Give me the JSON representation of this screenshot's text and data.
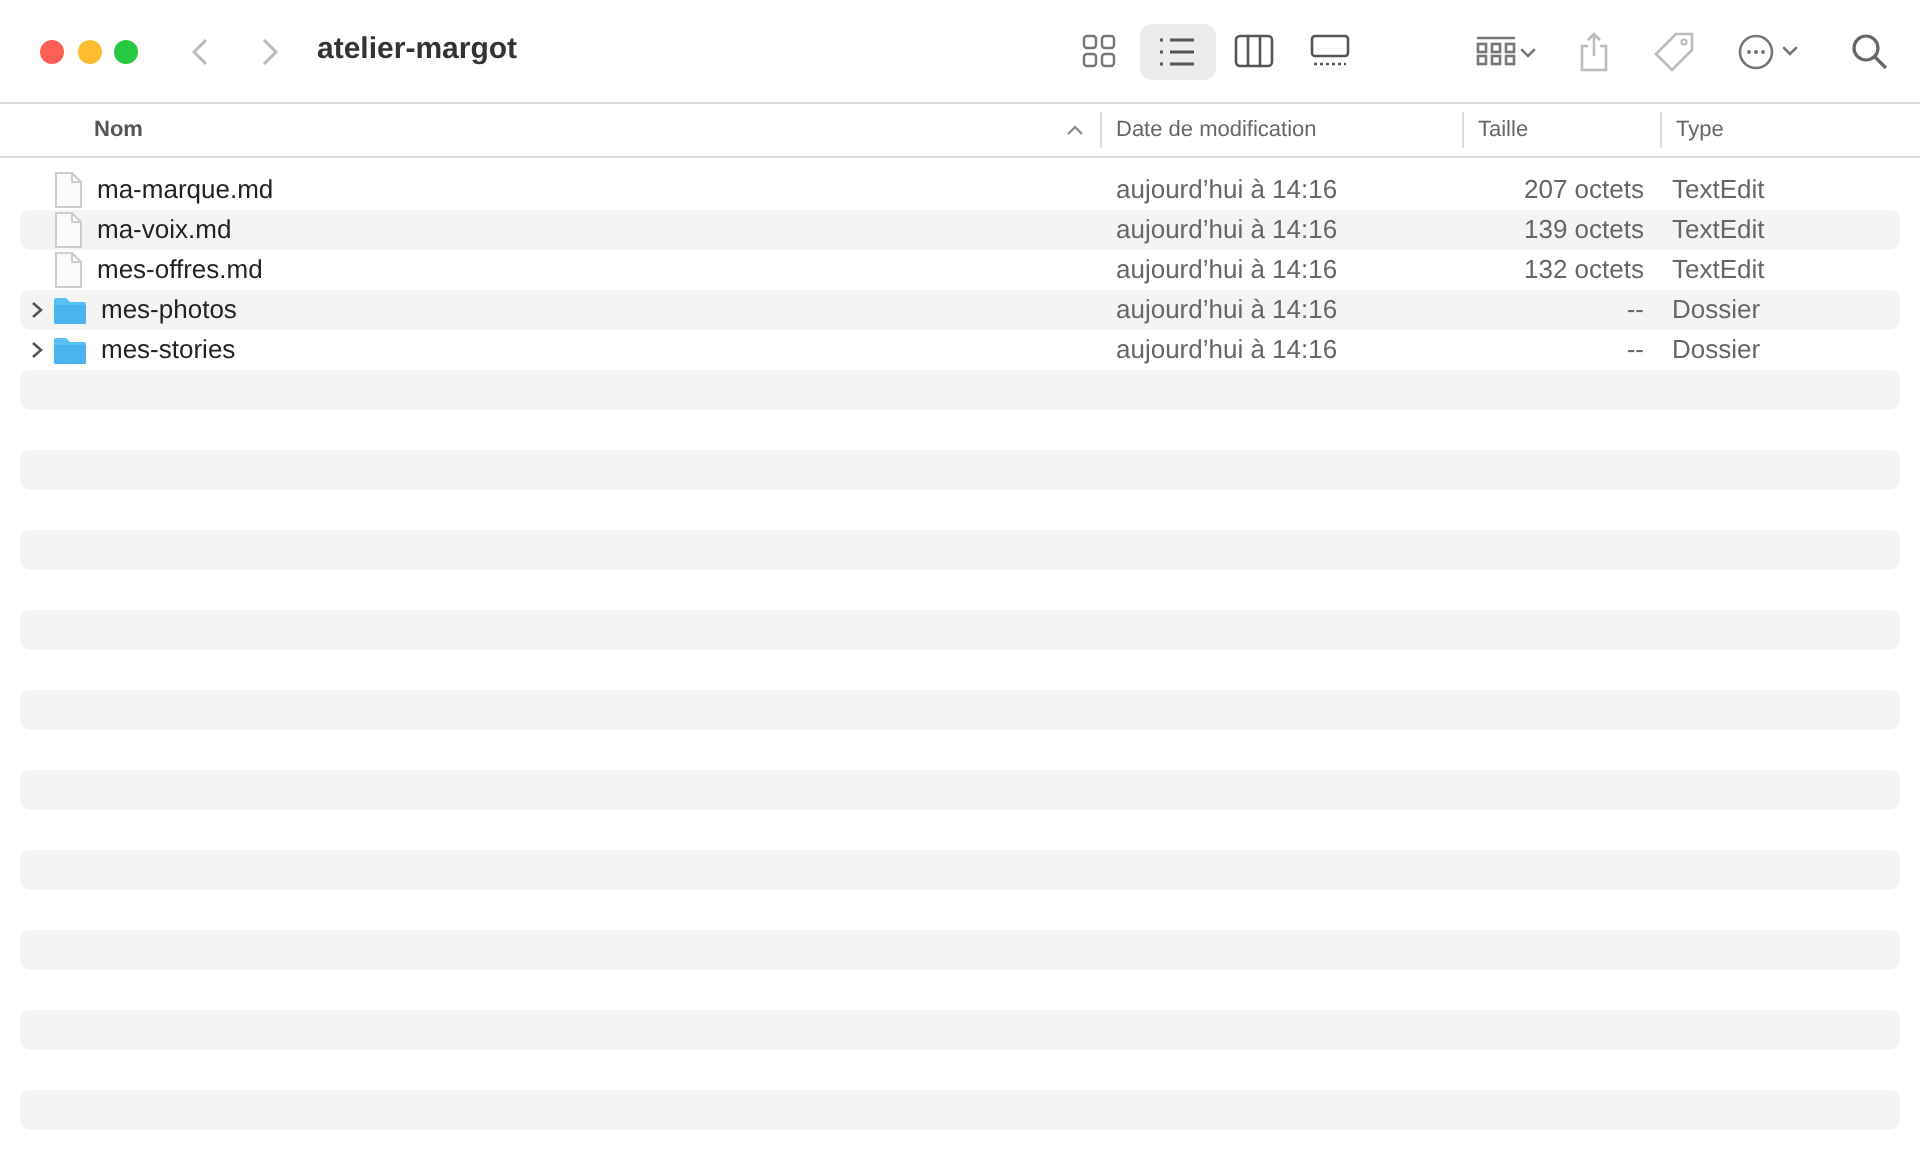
{
  "window": {
    "title": "atelier-margot"
  },
  "view_modes": [
    {
      "kind": "icons",
      "selected": false
    },
    {
      "kind": "list",
      "selected": true
    },
    {
      "kind": "columns",
      "selected": false
    },
    {
      "kind": "gallery",
      "selected": false
    }
  ],
  "columns": [
    {
      "label": "Nom",
      "sorted": true
    },
    {
      "label": "Date de modification",
      "sorted": false
    },
    {
      "label": "Taille",
      "sorted": false
    },
    {
      "label": "Type",
      "sorted": false
    }
  ],
  "rows": [
    {
      "kind": "file",
      "name": "ma-marque.md",
      "modified": "aujourd’hui à 14:16",
      "size": "207 octets",
      "type": "TextEdit"
    },
    {
      "kind": "file",
      "name": "ma-voix.md",
      "modified": "aujourd’hui à 14:16",
      "size": "139 octets",
      "type": "TextEdit"
    },
    {
      "kind": "file",
      "name": "mes-offres.md",
      "modified": "aujourd’hui à 14:16",
      "size": "132 octets",
      "type": "TextEdit"
    },
    {
      "kind": "folder",
      "name": "mes-photos",
      "modified": "aujourd’hui à 14:16",
      "size": "--",
      "type": "Dossier"
    },
    {
      "kind": "folder",
      "name": "mes-stories",
      "modified": "aujourd’hui à 14:16",
      "size": "--",
      "type": "Dossier"
    }
  ]
}
